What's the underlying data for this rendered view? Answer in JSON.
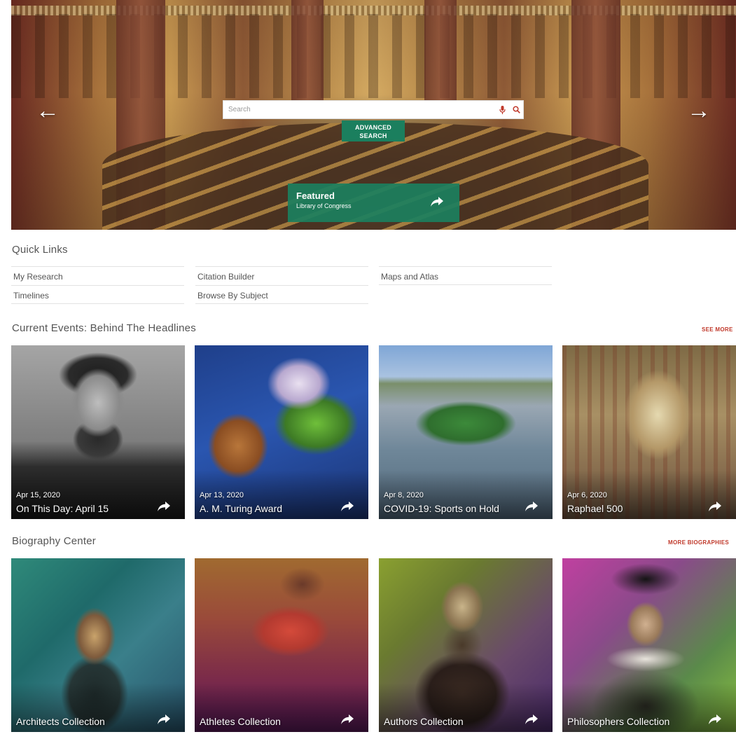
{
  "hero": {
    "search": {
      "placeholder": "Search"
    },
    "advanced_search_label": "ADVANCED SEARCH",
    "featured": {
      "title": "Featured",
      "subtitle": "Library of Congress"
    },
    "prev_arrow": "←",
    "next_arrow": "→"
  },
  "quick_links": {
    "title": "Quick Links",
    "items": [
      {
        "label": "My Research"
      },
      {
        "label": "Citation Builder"
      },
      {
        "label": "Maps and Atlas"
      },
      {
        "label": "Timelines"
      },
      {
        "label": "Browse By Subject"
      }
    ]
  },
  "current_events": {
    "title": "Current Events: Behind The Headlines",
    "see_more": "SEE MORE",
    "cards": [
      {
        "date": "Apr 15, 2020",
        "title": "On This Day: April 15"
      },
      {
        "date": "Apr 13, 2020",
        "title": "A. M. Turing Award"
      },
      {
        "date": "Apr 8, 2020",
        "title": "COVID-19: Sports on Hold"
      },
      {
        "date": "Apr 6, 2020",
        "title": "Raphael 500"
      }
    ]
  },
  "biography_center": {
    "title": "Biography Center",
    "see_more": "MORE BIOGRAPHIES",
    "cards": [
      {
        "title": "Architects Collection"
      },
      {
        "title": "Athletes Collection"
      },
      {
        "title": "Authors Collection"
      },
      {
        "title": "Philosophers Collection"
      }
    ]
  },
  "colors": {
    "accent_green": "#1b7f5e",
    "accent_red": "#c0392b"
  }
}
